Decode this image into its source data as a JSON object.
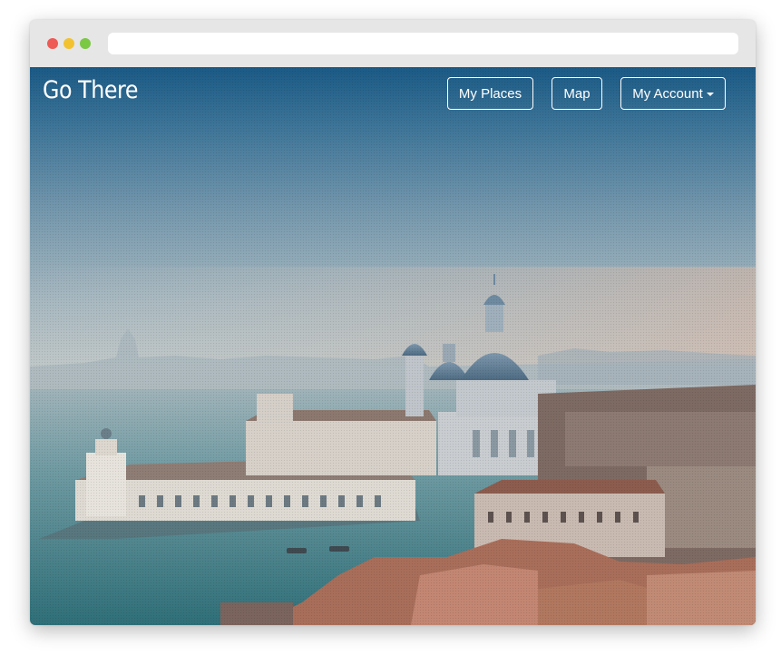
{
  "window": {
    "traffic_lights": [
      "close",
      "minimize",
      "zoom"
    ],
    "address_bar": ""
  },
  "header": {
    "brand": "Go There",
    "nav": {
      "my_places": "My Places",
      "map": "Map",
      "my_account": "My Account"
    },
    "dropdown_icon": "caret-down-icon"
  },
  "hero": {
    "image": "venice-aerial-photo"
  },
  "colors": {
    "nav_text": "#ffffff",
    "sky_top": "#1b5a86",
    "water": "#3f7f85"
  }
}
